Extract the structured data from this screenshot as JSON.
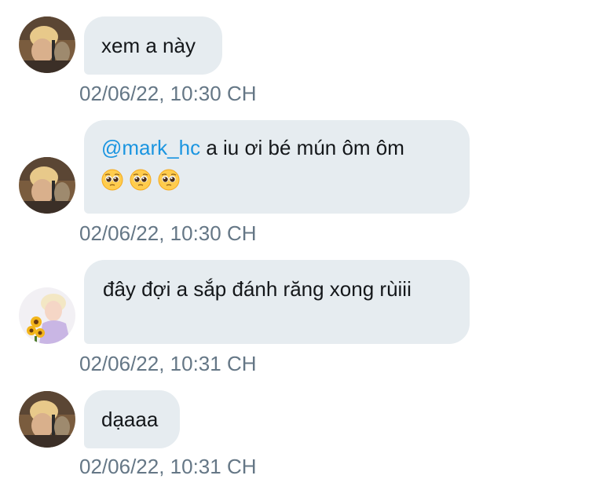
{
  "messages": [
    {
      "sender": "other",
      "mention": "",
      "text": "xem a này",
      "emojis": [],
      "timestamp": "02/06/22, 10:30 CH"
    },
    {
      "sender": "other",
      "mention": "@mark_hc",
      "text": " a iu ơi bé mún ôm ôm",
      "emojis": [
        "pleading-face",
        "pleading-face",
        "pleading-face"
      ],
      "timestamp": "02/06/22, 10:30 CH"
    },
    {
      "sender": "self",
      "mention": "",
      "text": " đây đợi a sắp đánh răng xong rùiii",
      "emojis": [],
      "timestamp": "02/06/22, 10:31 CH"
    },
    {
      "sender": "other",
      "mention": "",
      "text": "dạaaa",
      "emojis": [],
      "timestamp": "02/06/22, 10:31 CH"
    }
  ],
  "colors": {
    "bubble": "#e6ecf0",
    "text": "#14171a",
    "mention": "#1b95e0",
    "timestamp": "#657786"
  }
}
